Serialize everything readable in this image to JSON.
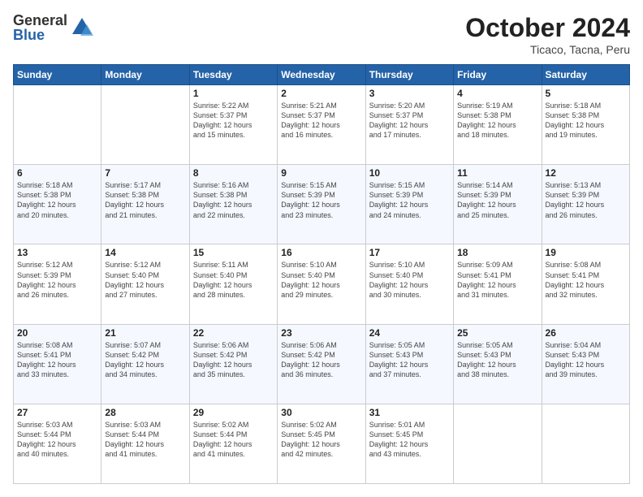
{
  "logo": {
    "general": "General",
    "blue": "Blue"
  },
  "header": {
    "month": "October 2024",
    "location": "Ticaco, Tacna, Peru"
  },
  "weekdays": [
    "Sunday",
    "Monday",
    "Tuesday",
    "Wednesday",
    "Thursday",
    "Friday",
    "Saturday"
  ],
  "weeks": [
    [
      {
        "day": "",
        "info": ""
      },
      {
        "day": "",
        "info": ""
      },
      {
        "day": "1",
        "info": "Sunrise: 5:22 AM\nSunset: 5:37 PM\nDaylight: 12 hours\nand 15 minutes."
      },
      {
        "day": "2",
        "info": "Sunrise: 5:21 AM\nSunset: 5:37 PM\nDaylight: 12 hours\nand 16 minutes."
      },
      {
        "day": "3",
        "info": "Sunrise: 5:20 AM\nSunset: 5:37 PM\nDaylight: 12 hours\nand 17 minutes."
      },
      {
        "day": "4",
        "info": "Sunrise: 5:19 AM\nSunset: 5:38 PM\nDaylight: 12 hours\nand 18 minutes."
      },
      {
        "day": "5",
        "info": "Sunrise: 5:18 AM\nSunset: 5:38 PM\nDaylight: 12 hours\nand 19 minutes."
      }
    ],
    [
      {
        "day": "6",
        "info": "Sunrise: 5:18 AM\nSunset: 5:38 PM\nDaylight: 12 hours\nand 20 minutes."
      },
      {
        "day": "7",
        "info": "Sunrise: 5:17 AM\nSunset: 5:38 PM\nDaylight: 12 hours\nand 21 minutes."
      },
      {
        "day": "8",
        "info": "Sunrise: 5:16 AM\nSunset: 5:38 PM\nDaylight: 12 hours\nand 22 minutes."
      },
      {
        "day": "9",
        "info": "Sunrise: 5:15 AM\nSunset: 5:39 PM\nDaylight: 12 hours\nand 23 minutes."
      },
      {
        "day": "10",
        "info": "Sunrise: 5:15 AM\nSunset: 5:39 PM\nDaylight: 12 hours\nand 24 minutes."
      },
      {
        "day": "11",
        "info": "Sunrise: 5:14 AM\nSunset: 5:39 PM\nDaylight: 12 hours\nand 25 minutes."
      },
      {
        "day": "12",
        "info": "Sunrise: 5:13 AM\nSunset: 5:39 PM\nDaylight: 12 hours\nand 26 minutes."
      }
    ],
    [
      {
        "day": "13",
        "info": "Sunrise: 5:12 AM\nSunset: 5:39 PM\nDaylight: 12 hours\nand 26 minutes."
      },
      {
        "day": "14",
        "info": "Sunrise: 5:12 AM\nSunset: 5:40 PM\nDaylight: 12 hours\nand 27 minutes."
      },
      {
        "day": "15",
        "info": "Sunrise: 5:11 AM\nSunset: 5:40 PM\nDaylight: 12 hours\nand 28 minutes."
      },
      {
        "day": "16",
        "info": "Sunrise: 5:10 AM\nSunset: 5:40 PM\nDaylight: 12 hours\nand 29 minutes."
      },
      {
        "day": "17",
        "info": "Sunrise: 5:10 AM\nSunset: 5:40 PM\nDaylight: 12 hours\nand 30 minutes."
      },
      {
        "day": "18",
        "info": "Sunrise: 5:09 AM\nSunset: 5:41 PM\nDaylight: 12 hours\nand 31 minutes."
      },
      {
        "day": "19",
        "info": "Sunrise: 5:08 AM\nSunset: 5:41 PM\nDaylight: 12 hours\nand 32 minutes."
      }
    ],
    [
      {
        "day": "20",
        "info": "Sunrise: 5:08 AM\nSunset: 5:41 PM\nDaylight: 12 hours\nand 33 minutes."
      },
      {
        "day": "21",
        "info": "Sunrise: 5:07 AM\nSunset: 5:42 PM\nDaylight: 12 hours\nand 34 minutes."
      },
      {
        "day": "22",
        "info": "Sunrise: 5:06 AM\nSunset: 5:42 PM\nDaylight: 12 hours\nand 35 minutes."
      },
      {
        "day": "23",
        "info": "Sunrise: 5:06 AM\nSunset: 5:42 PM\nDaylight: 12 hours\nand 36 minutes."
      },
      {
        "day": "24",
        "info": "Sunrise: 5:05 AM\nSunset: 5:43 PM\nDaylight: 12 hours\nand 37 minutes."
      },
      {
        "day": "25",
        "info": "Sunrise: 5:05 AM\nSunset: 5:43 PM\nDaylight: 12 hours\nand 38 minutes."
      },
      {
        "day": "26",
        "info": "Sunrise: 5:04 AM\nSunset: 5:43 PM\nDaylight: 12 hours\nand 39 minutes."
      }
    ],
    [
      {
        "day": "27",
        "info": "Sunrise: 5:03 AM\nSunset: 5:44 PM\nDaylight: 12 hours\nand 40 minutes."
      },
      {
        "day": "28",
        "info": "Sunrise: 5:03 AM\nSunset: 5:44 PM\nDaylight: 12 hours\nand 41 minutes."
      },
      {
        "day": "29",
        "info": "Sunrise: 5:02 AM\nSunset: 5:44 PM\nDaylight: 12 hours\nand 41 minutes."
      },
      {
        "day": "30",
        "info": "Sunrise: 5:02 AM\nSunset: 5:45 PM\nDaylight: 12 hours\nand 42 minutes."
      },
      {
        "day": "31",
        "info": "Sunrise: 5:01 AM\nSunset: 5:45 PM\nDaylight: 12 hours\nand 43 minutes."
      },
      {
        "day": "",
        "info": ""
      },
      {
        "day": "",
        "info": ""
      }
    ]
  ]
}
